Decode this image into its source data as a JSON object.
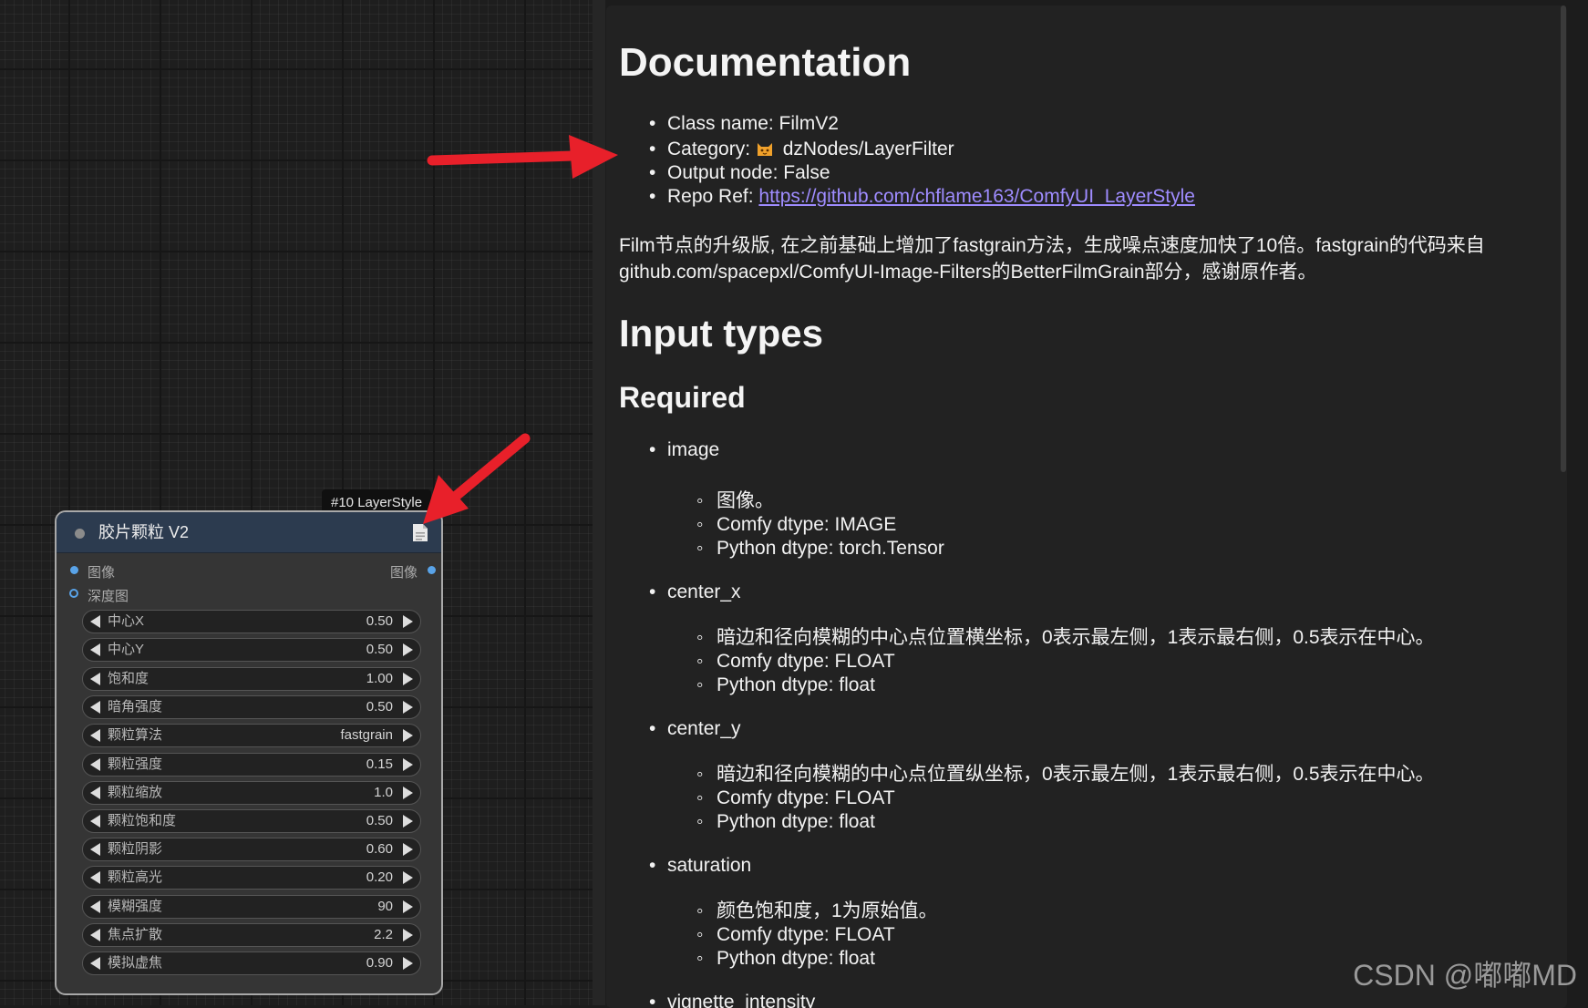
{
  "canvas": {
    "node_badge": "#10 LayerStyle",
    "node": {
      "title": "胶片颗粒 V2",
      "inputs": [
        {
          "label": "图像"
        },
        {
          "label": "深度图"
        }
      ],
      "outputs": [
        {
          "label": "图像"
        }
      ],
      "widgets": [
        {
          "label": "中心X",
          "value": "0.50"
        },
        {
          "label": "中心Y",
          "value": "0.50"
        },
        {
          "label": "饱和度",
          "value": "1.00"
        },
        {
          "label": "暗角强度",
          "value": "0.50"
        },
        {
          "label": "颗粒算法",
          "value": "fastgrain"
        },
        {
          "label": "颗粒强度",
          "value": "0.15"
        },
        {
          "label": "颗粒缩放",
          "value": "1.0"
        },
        {
          "label": "颗粒饱和度",
          "value": "0.50"
        },
        {
          "label": "颗粒阴影",
          "value": "0.60"
        },
        {
          "label": "颗粒高光",
          "value": "0.20"
        },
        {
          "label": "模糊强度",
          "value": "90"
        },
        {
          "label": "焦点扩散",
          "value": "2.2"
        },
        {
          "label": "模拟虚焦",
          "value": "0.90"
        }
      ]
    }
  },
  "docs": {
    "title": "Documentation",
    "meta": {
      "class_name": "Class name: FilmV2",
      "category_prefix": "Category: ",
      "category_value": "dzNodes/LayerFilter",
      "output_node": "Output node: False",
      "repo_prefix": "Repo Ref: ",
      "repo_link": "https://github.com/chflame163/ComfyUI_LayerStyle"
    },
    "description_line1": "Film节点的升级版, 在之前基础上增加了fastgrain方法，生成噪点速度加快了10倍。fastgrain的代码来自",
    "description_line2": "github.com/spacepxl/ComfyUI-Image-Filters的BetterFilmGrain部分，感谢原作者。",
    "input_types_heading": "Input types",
    "required_heading": "Required",
    "inputs": [
      {
        "name": "image",
        "desc": "图像。",
        "comfy": "Comfy dtype: IMAGE",
        "python": "Python dtype: torch.Tensor"
      },
      {
        "name": "center_x",
        "desc": "暗边和径向模糊的中心点位置横坐标，0表示最左侧，1表示最右侧，0.5表示在中心。",
        "comfy": "Comfy dtype: FLOAT",
        "python": "Python dtype: float"
      },
      {
        "name": "center_y",
        "desc": "暗边和径向模糊的中心点位置纵坐标，0表示最左侧，1表示最右侧，0.5表示在中心。",
        "comfy": "Comfy dtype: FLOAT",
        "python": "Python dtype: float"
      },
      {
        "name": "saturation",
        "desc": "颜色饱和度，1为原始值。",
        "comfy": "Comfy dtype: FLOAT",
        "python": "Python dtype: float"
      },
      {
        "name": "vignette_intensity"
      }
    ]
  },
  "watermark": "CSDN @嘟嘟MD",
  "colors": {
    "arrow": "#e8202a",
    "link": "#9f8cff",
    "slot": "#59a3e8"
  }
}
